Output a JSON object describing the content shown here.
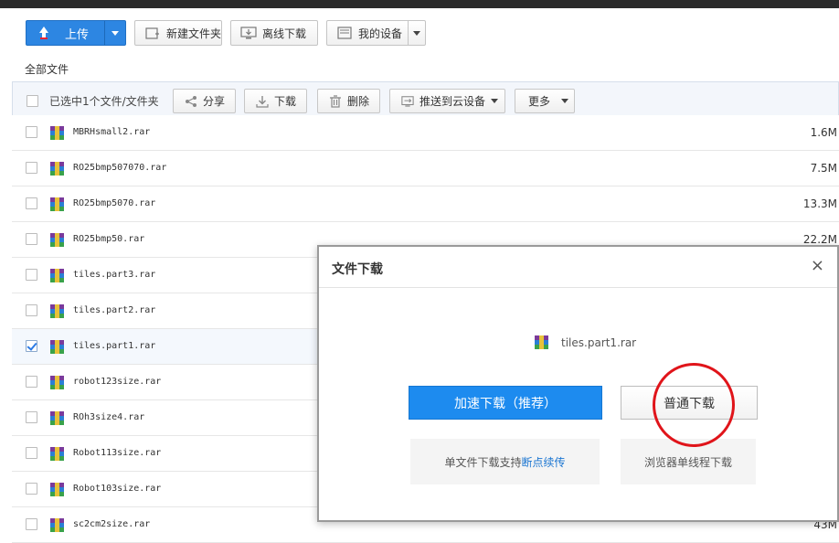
{
  "toolbar": {
    "upload_label": "上传",
    "new_folder_label": "新建文件夹",
    "offline_download_label": "离线下载",
    "my_devices_label": "我的设备"
  },
  "breadcrumb": "全部文件",
  "selection_bar": {
    "status": "已选中1个文件/文件夹",
    "share_label": "分享",
    "download_label": "下载",
    "delete_label": "删除",
    "push_device_label": "推送到云设备",
    "more_label": "更多"
  },
  "files": [
    {
      "name": "MBRHsmall2.rar",
      "size": "1.6M",
      "checked": false
    },
    {
      "name": "RO25bmp507070.rar",
      "size": "7.5M",
      "checked": false
    },
    {
      "name": "RO25bmp5070.rar",
      "size": "13.3M",
      "checked": false
    },
    {
      "name": "RO25bmp50.rar",
      "size": "22.2M",
      "checked": false
    },
    {
      "name": "tiles.part3.rar",
      "size": "",
      "checked": false
    },
    {
      "name": "tiles.part2.rar",
      "size": "",
      "checked": false
    },
    {
      "name": "tiles.part1.rar",
      "size": "",
      "checked": true
    },
    {
      "name": "robot123size.rar",
      "size": "",
      "checked": false
    },
    {
      "name": "ROh3size4.rar",
      "size": "",
      "checked": false
    },
    {
      "name": "Robot113size.rar",
      "size": "",
      "checked": false
    },
    {
      "name": "Robot103size.rar",
      "size": "",
      "checked": false
    },
    {
      "name": "sc2cm2size.rar",
      "size": "43M",
      "checked": false
    }
  ],
  "dialog": {
    "title": "文件下载",
    "close_glyph": "×",
    "file_name": "tiles.part1.rar",
    "fast_download_label": "加速下载（推荐）",
    "normal_download_label": "普通下载",
    "fast_hint_prefix": "单文件下载支持",
    "fast_hint_highlight": "断点续传",
    "normal_hint": "浏览器单线程下载"
  },
  "colors": {
    "accent_blue": "#2d86e2",
    "fast_button_blue": "#1d8bef",
    "annotation_red": "#e0141a"
  }
}
